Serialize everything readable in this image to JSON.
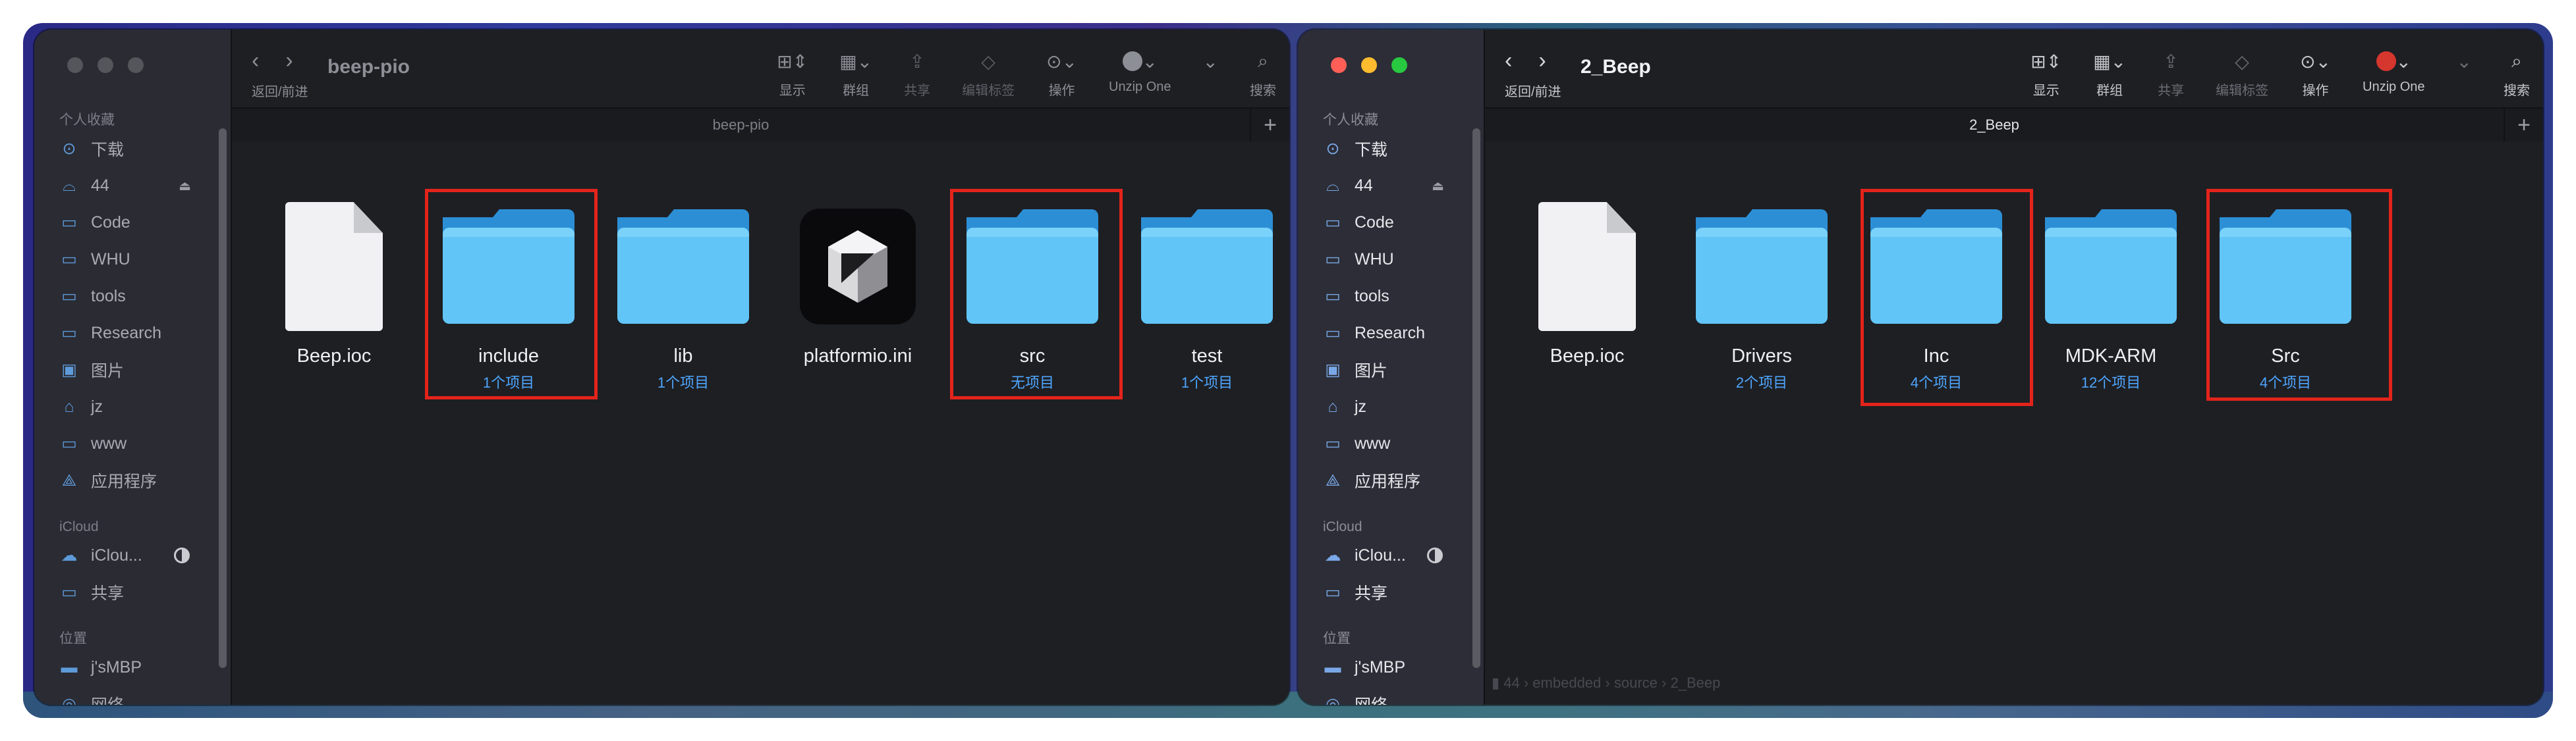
{
  "left_window": {
    "title": "beep-pio",
    "tab_label": "beep-pio",
    "nav_caption": "返回/前进",
    "sidebar": {
      "favorites_title": "个人收藏",
      "favorites": [
        {
          "label": "下载",
          "icon": "download-icon"
        },
        {
          "label": "44",
          "icon": "disk-icon"
        },
        {
          "label": "Code",
          "icon": "folder-icon"
        },
        {
          "label": "WHU",
          "icon": "folder-icon"
        },
        {
          "label": "tools",
          "icon": "folder-icon"
        },
        {
          "label": "Research",
          "icon": "folder-icon"
        },
        {
          "label": "图片",
          "icon": "image-icon"
        },
        {
          "label": "jz",
          "icon": "home-icon"
        },
        {
          "label": "www",
          "icon": "folder-icon"
        },
        {
          "label": "应用程序",
          "icon": "apps-icon"
        }
      ],
      "icloud_title": "iCloud",
      "icloud": [
        {
          "label": "iClou...",
          "icon": "cloud-icon"
        },
        {
          "label": "共享",
          "icon": "shared-folder-icon"
        }
      ],
      "locations_title": "位置",
      "locations": [
        {
          "label": "j'sMBP",
          "icon": "laptop-icon"
        },
        {
          "label": "网络",
          "icon": "network-icon"
        }
      ]
    },
    "toolbar": {
      "view": "显示",
      "group": "群组",
      "share": "共享",
      "tags": "编辑标签",
      "action": "操作",
      "unzip": "Unzip One",
      "search": "搜索"
    },
    "files": [
      {
        "name": "Beep.ioc",
        "count": "",
        "kind": "document"
      },
      {
        "name": "include",
        "count": "1个项目",
        "kind": "folder"
      },
      {
        "name": "lib",
        "count": "1个项目",
        "kind": "folder"
      },
      {
        "name": "platformio.ini",
        "count": "",
        "kind": "platformio"
      },
      {
        "name": "src",
        "count": "无项目",
        "kind": "folder"
      },
      {
        "name": "test",
        "count": "1个项目",
        "kind": "folder"
      }
    ]
  },
  "right_window": {
    "title": "2_Beep",
    "tab_label": "2_Beep",
    "nav_caption": "返回/前进",
    "sidebar": {
      "favorites_title": "个人收藏",
      "favorites": [
        {
          "label": "下载",
          "icon": "download-icon"
        },
        {
          "label": "44",
          "icon": "disk-icon"
        },
        {
          "label": "Code",
          "icon": "folder-icon"
        },
        {
          "label": "WHU",
          "icon": "folder-icon"
        },
        {
          "label": "tools",
          "icon": "folder-icon"
        },
        {
          "label": "Research",
          "icon": "folder-icon"
        },
        {
          "label": "图片",
          "icon": "image-icon"
        },
        {
          "label": "jz",
          "icon": "home-icon"
        },
        {
          "label": "www",
          "icon": "folder-icon"
        },
        {
          "label": "应用程序",
          "icon": "apps-icon"
        }
      ],
      "icloud_title": "iCloud",
      "icloud": [
        {
          "label": "iClou...",
          "icon": "cloud-icon"
        },
        {
          "label": "共享",
          "icon": "shared-folder-icon"
        }
      ],
      "locations_title": "位置",
      "locations": [
        {
          "label": "j'sMBP",
          "icon": "laptop-icon"
        },
        {
          "label": "网络",
          "icon": "network-icon"
        }
      ]
    },
    "toolbar": {
      "view": "显示",
      "group": "群组",
      "share": "共享",
      "tags": "编辑标签",
      "action": "操作",
      "unzip": "Unzip One",
      "search": "搜索"
    },
    "files": [
      {
        "name": "Beep.ioc",
        "count": "",
        "kind": "document"
      },
      {
        "name": "Drivers",
        "count": "2个项目",
        "kind": "folder"
      },
      {
        "name": "Inc",
        "count": "4个项目",
        "kind": "folder"
      },
      {
        "name": "MDK-ARM",
        "count": "12个项目",
        "kind": "folder"
      },
      {
        "name": "Src",
        "count": "4个项目",
        "kind": "folder"
      }
    ],
    "path_bar": [
      "44",
      "embedded",
      "source",
      "2_Beep"
    ]
  },
  "colors": {
    "highlight": "#e3241b",
    "folder_blue": "#61c5f7",
    "count_blue": "#4ea6ff"
  }
}
